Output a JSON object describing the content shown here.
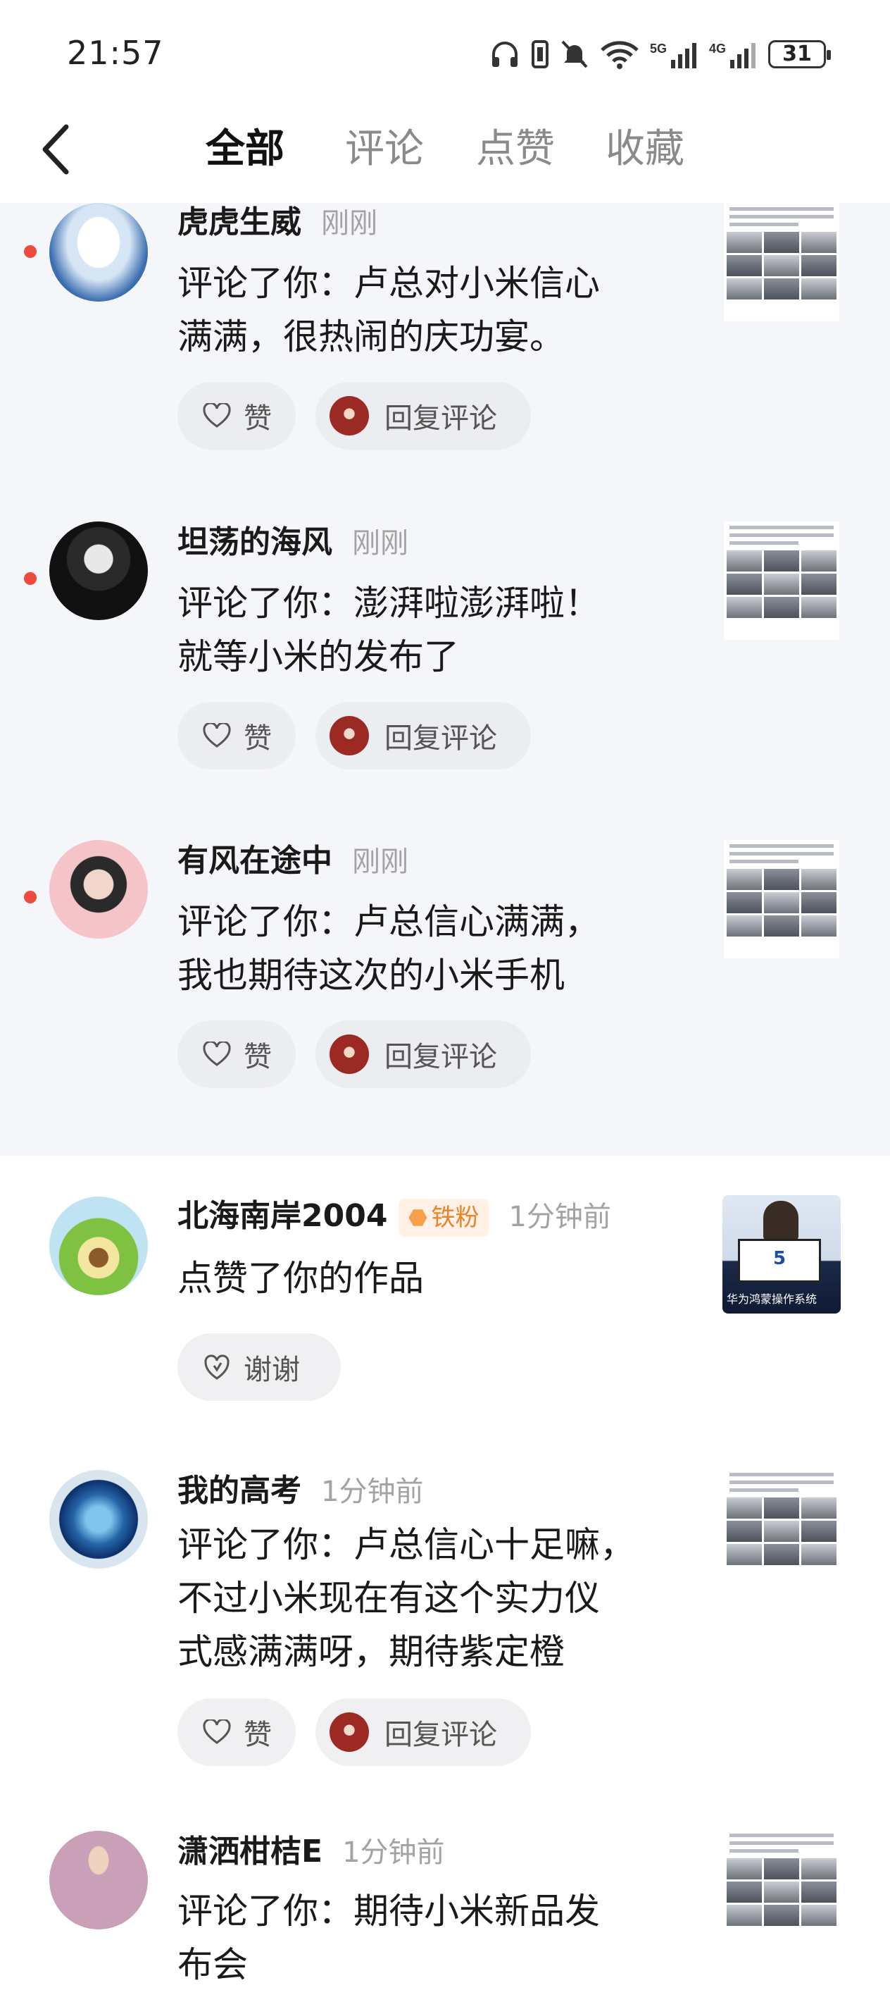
{
  "status_bar": {
    "time": "21:57",
    "network1": "5G",
    "network2": "4G",
    "battery": "31"
  },
  "tabs": [
    {
      "label": "全部",
      "active": true
    },
    {
      "label": "评论",
      "active": false
    },
    {
      "label": "点赞",
      "active": false
    },
    {
      "label": "收藏",
      "active": false
    }
  ],
  "buttons": {
    "like": "赞",
    "reply": "回复评论",
    "thanks": "谢谢"
  },
  "notifications": [
    {
      "name": "虎虎生威",
      "time": "刚刚",
      "line1": "评论了你：卢总对小米信心",
      "line2": "满满，很热闹的庆功宴。",
      "unread": true
    },
    {
      "name": "坦荡的海风",
      "time": "刚刚",
      "line1": "评论了你：澎湃啦澎湃啦！",
      "line2": "就等小米的发布了",
      "unread": true
    },
    {
      "name": "有风在途中",
      "time": "刚刚",
      "line1": "评论了你：卢总信心满满，",
      "line2": "我也期待这次的小米手机",
      "unread": true
    },
    {
      "name": "北海南岸2004",
      "badge": "铁粉",
      "time": "1分钟前",
      "line1": "点赞了你的作品",
      "thumb_caption": "华为鸿蒙操作系统",
      "thumb_screen": "5",
      "unread": false
    },
    {
      "name": "我的高考",
      "time": "1分钟前",
      "line1": "评论了你：卢总信心十足嘛，",
      "line2": "不过小米现在有这个实力仪",
      "line3": "式感满满呀，期待紫定橙",
      "unread": false
    },
    {
      "name": "潇洒柑桔E",
      "time": "1分钟前",
      "line1": "评论了你：期待小米新品发",
      "line2": "布会",
      "unread": false
    }
  ],
  "colors": {
    "unread_dot": "#ef4a3e",
    "unread_bg": "#f5f6f9",
    "badge_text": "#e8852b"
  }
}
